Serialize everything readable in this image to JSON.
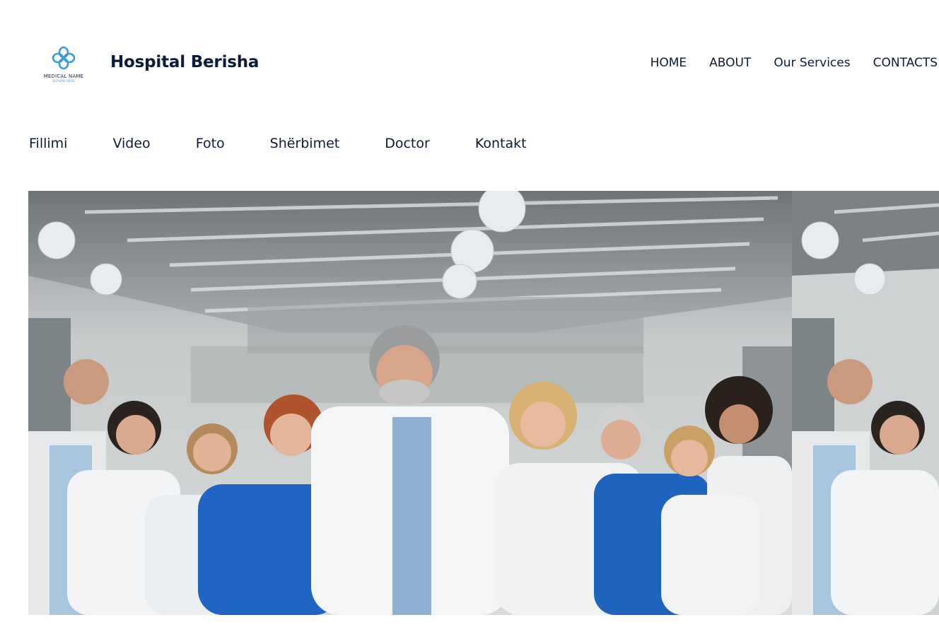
{
  "header": {
    "logo": {
      "text": "MEDICAL NAME",
      "subtext": "SLOGAN HERE",
      "icon": "cross-knot-logo-icon",
      "color": "#3a9bd5"
    },
    "site_title": "Hospital Berisha",
    "nav": [
      {
        "label": "HOME"
      },
      {
        "label": "ABOUT"
      },
      {
        "label": "Our Services"
      },
      {
        "label": "CONTACTS"
      }
    ]
  },
  "subnav": [
    {
      "label": "Fillimi"
    },
    {
      "label": "Video"
    },
    {
      "label": "Foto"
    },
    {
      "label": "Shërbimet"
    },
    {
      "label": "Doctor"
    },
    {
      "label": "Kontakt"
    }
  ],
  "hero": {
    "image": "medical-team-photo",
    "colors": {
      "scrubs": "#1f66c4",
      "coat": "#f2f3f5",
      "background": "#c9ccce"
    }
  }
}
